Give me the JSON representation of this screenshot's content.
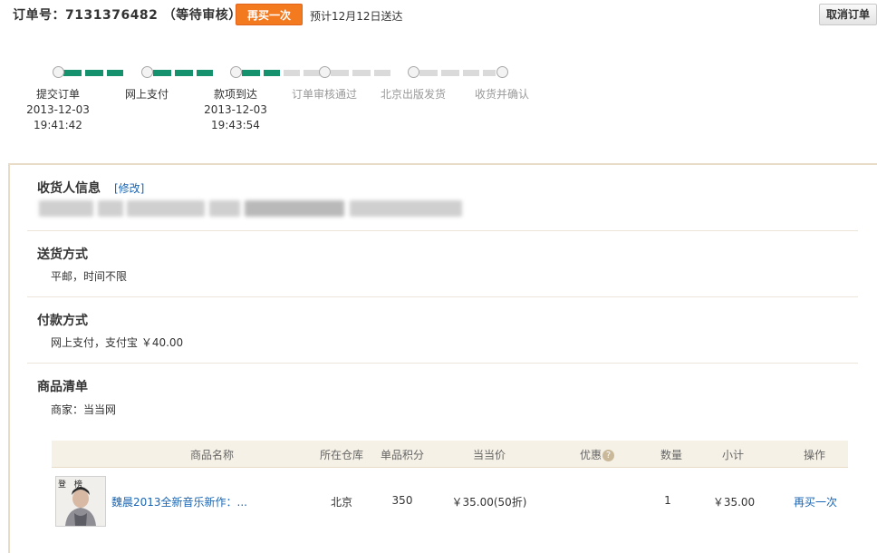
{
  "header": {
    "order_title": "订单号：7131376482 （等待审核）",
    "rebuy_label": "再买一次",
    "eta": "预计12月12日送达",
    "cancel_label": "取消订单"
  },
  "progress": {
    "steps": [
      {
        "label": "提交订单",
        "date": "2013-12-03",
        "time": "19:41:42",
        "status": "done"
      },
      {
        "label": "网上支付",
        "date": "",
        "time": "",
        "status": "done"
      },
      {
        "label": "款项到达",
        "date": "2013-12-03",
        "time": "19:43:54",
        "status": "done"
      },
      {
        "label": "订单审核通过",
        "date": "",
        "time": "",
        "status": "todo"
      },
      {
        "label": "北京出版发货",
        "date": "",
        "time": "",
        "status": "todo"
      },
      {
        "label": "收货并确认",
        "date": "",
        "time": "",
        "status": "todo"
      }
    ],
    "colors": {
      "done": "#16916d",
      "todo": "#dadada"
    }
  },
  "receiver": {
    "title": "收货人信息",
    "edit_label": "[修改]"
  },
  "delivery": {
    "title": "送货方式",
    "text": "平邮，时间不限"
  },
  "payment": {
    "title": "付款方式",
    "text": "网上支付，支付宝 ￥40.00"
  },
  "goods": {
    "title": "商品清单",
    "seller": "商家：当当网",
    "columns": [
      "商品名称",
      "所在仓库",
      "单品积分",
      "当当价",
      "优惠",
      "数量",
      "小计",
      "操作"
    ],
    "help_icon": "?",
    "rows": [
      {
        "thumb_caption": "登 榜",
        "name": "魏晨2013全新音乐新作：...",
        "warehouse": "北京",
        "points": "350",
        "price": "￥35.00(50折)",
        "discount": "",
        "qty": "1",
        "subtotal": "￥35.00",
        "action": "再买一次"
      }
    ]
  },
  "colors": {
    "accent": "#f47a20",
    "link": "#1a66b3",
    "progress_done": "#16916d",
    "panel_border": "#e8dcc6"
  }
}
